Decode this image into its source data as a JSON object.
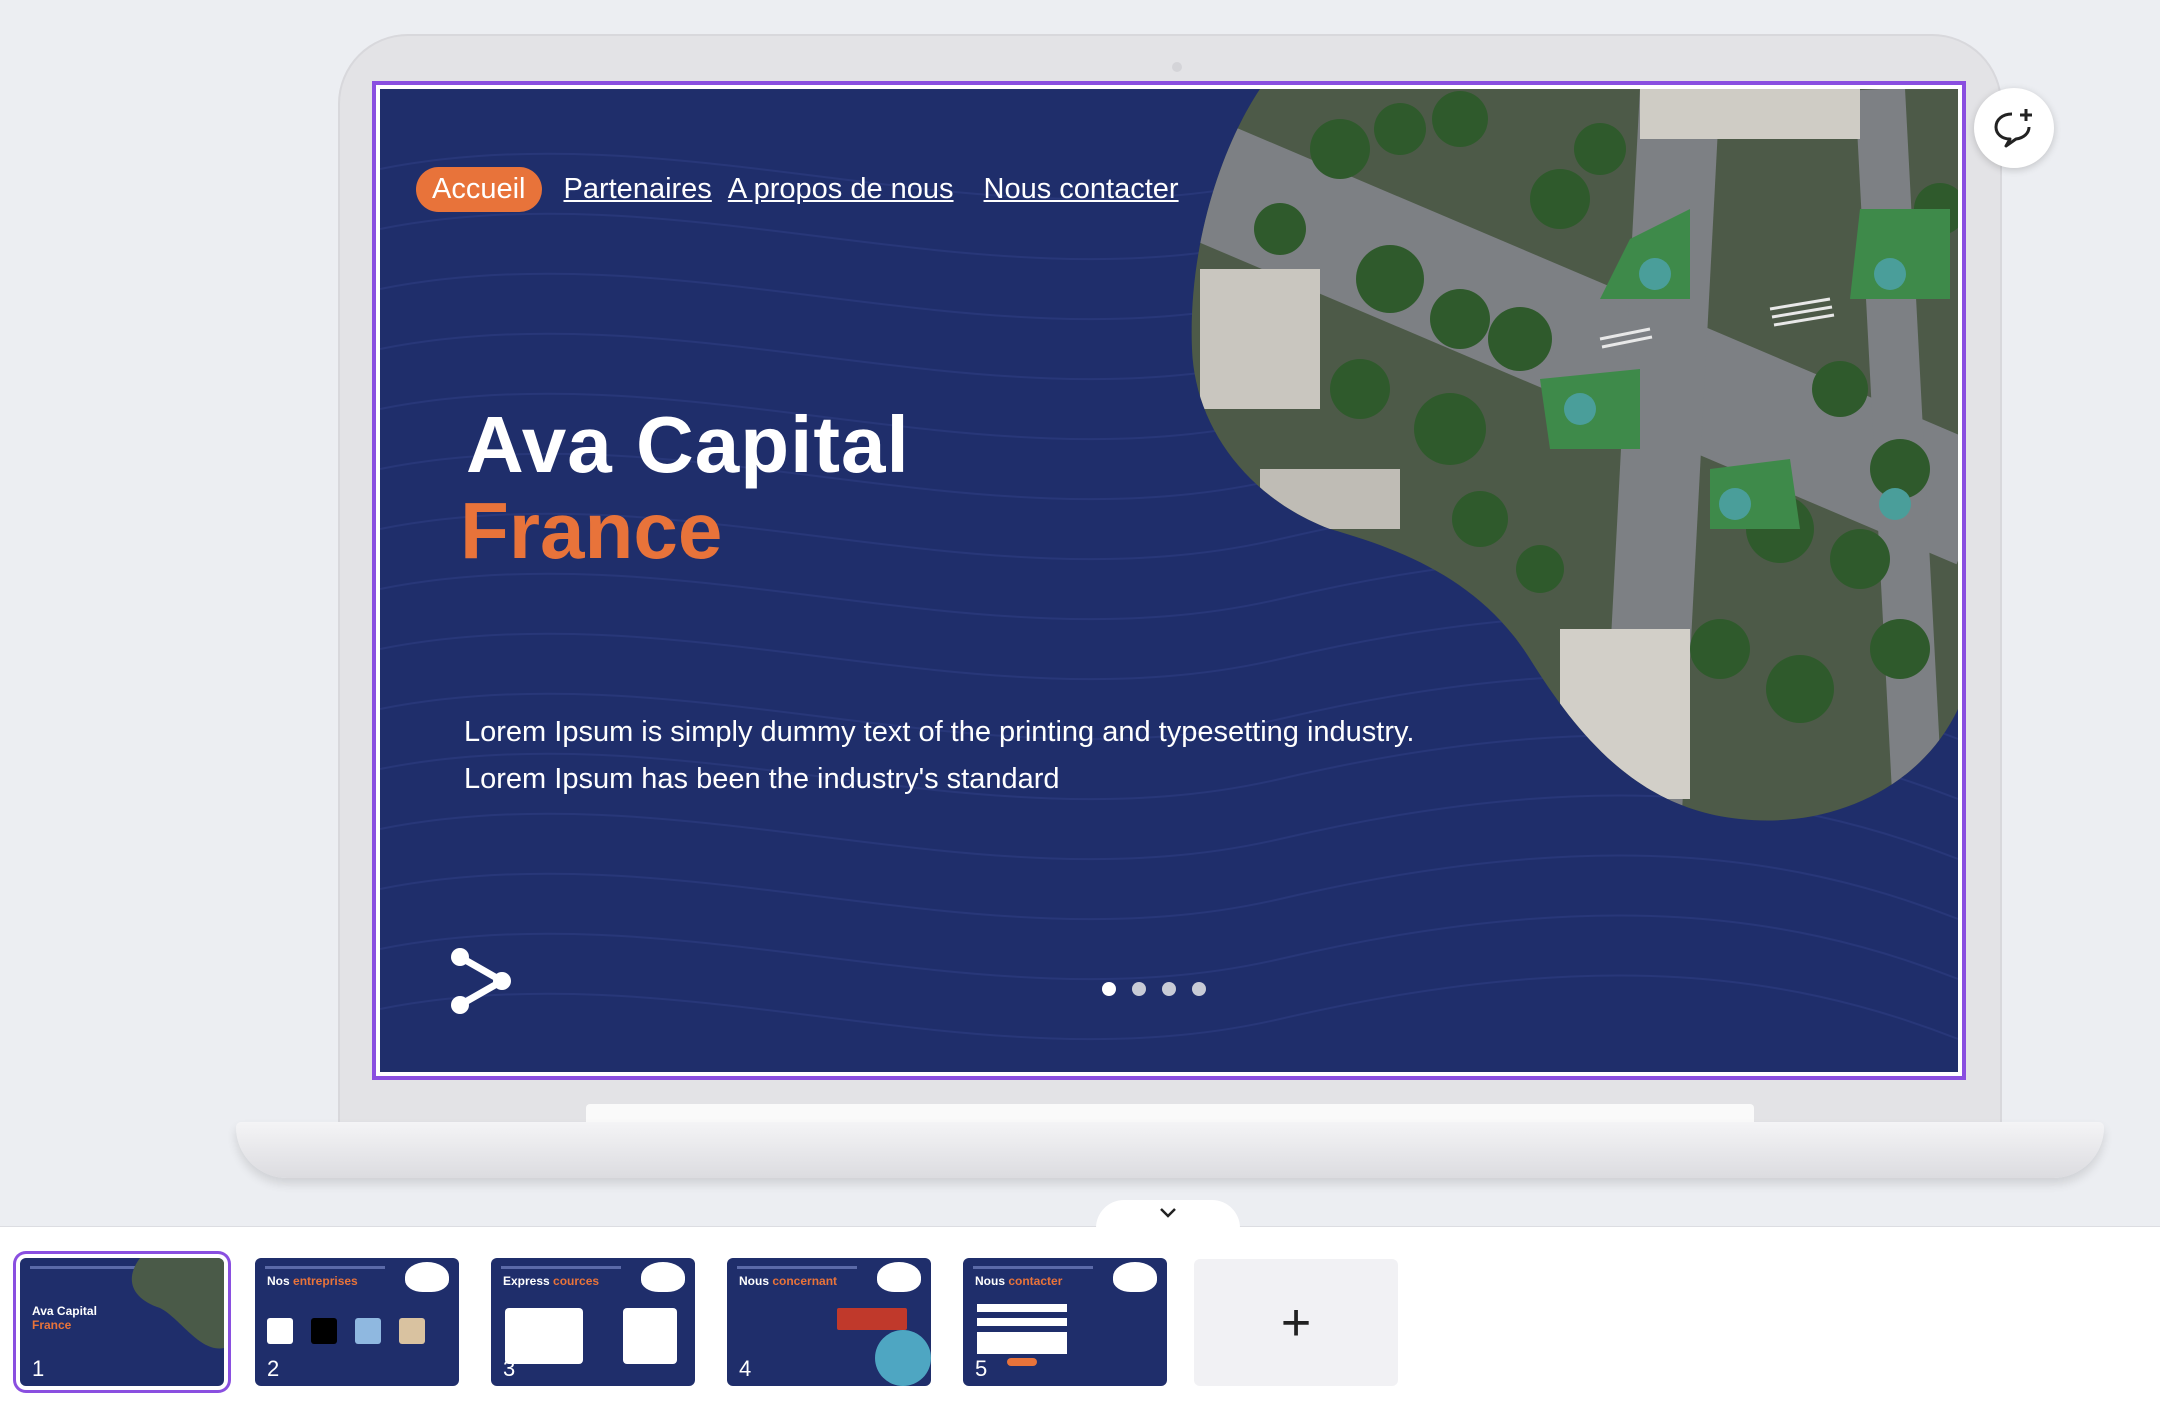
{
  "slide": {
    "nav": {
      "home": "Accueil",
      "partners": "Partenaires",
      "about": "A propos de nous",
      "contact": "Nous contacter"
    },
    "title": "Ava  Capital",
    "subtitle": "France",
    "body": "Lorem Ipsum is simply dummy text of the printing and typesetting industry. Lorem Ipsum has been the industry's standard",
    "pagination": {
      "count": 4,
      "active": 1
    }
  },
  "thumbnails": [
    {
      "number": "1",
      "title_white": "Ava Capital",
      "title_orange": "France",
      "selected": true
    },
    {
      "number": "2",
      "title_white": "Nos",
      "title_orange": "entreprises",
      "selected": false
    },
    {
      "number": "3",
      "title_white": "Express",
      "title_orange": "cources",
      "selected": false
    },
    {
      "number": "4",
      "title_white": "Nous",
      "title_orange": "concernant",
      "selected": false
    },
    {
      "number": "5",
      "title_white": "Nous",
      "title_orange": "contacter",
      "selected": false
    }
  ],
  "add_slide_symbol": "+",
  "colors": {
    "slide_bg": "#1f2e6b",
    "accent": "#e8733a",
    "selection": "#8a4fe0"
  },
  "icons": [
    "share-icon",
    "add-comment-icon",
    "chevron-down-icon",
    "plus-icon"
  ]
}
